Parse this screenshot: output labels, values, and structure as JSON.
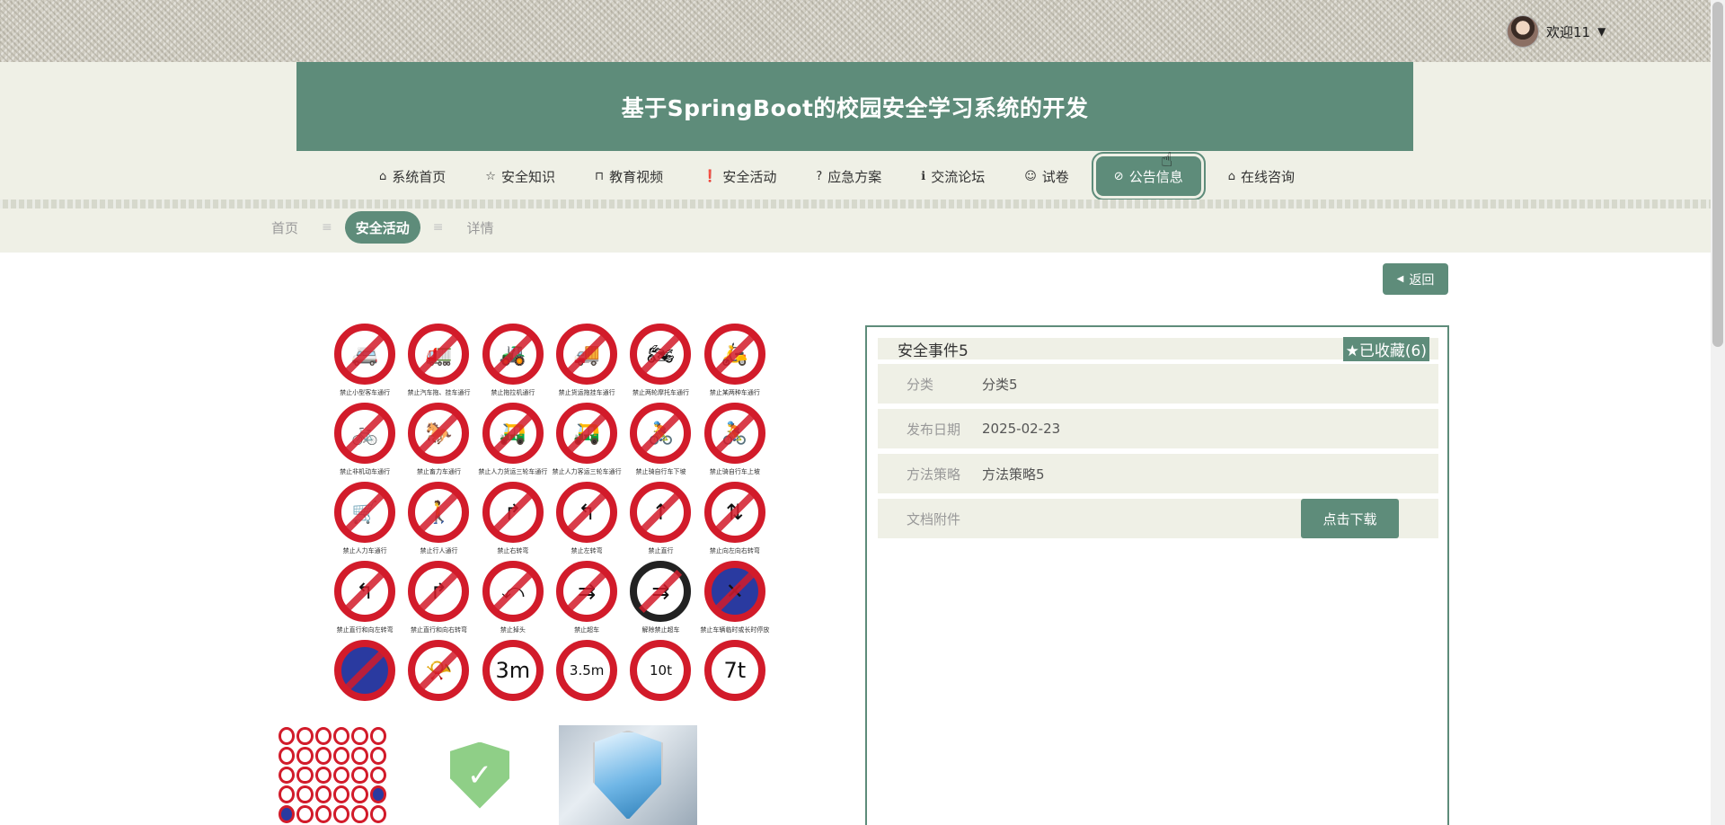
{
  "header": {
    "user_greeting": "欢迎11",
    "caret": "▼",
    "site_title": "基于SpringBoot的校园安全学习系统的开发"
  },
  "nav": {
    "items": [
      {
        "label": "系统首页",
        "icon": "home-icon",
        "glyph": "⌂"
      },
      {
        "label": "安全知识",
        "icon": "star-icon",
        "glyph": "☆"
      },
      {
        "label": "教育视频",
        "icon": "bag-icon",
        "glyph": "⊓"
      },
      {
        "label": "安全活动",
        "icon": "exclamation-circle-icon",
        "glyph": "❗"
      },
      {
        "label": "应急方案",
        "icon": "question-circle-icon",
        "glyph": "?"
      },
      {
        "label": "交流论坛",
        "icon": "info-circle-icon",
        "glyph": "ℹ"
      },
      {
        "label": "试卷",
        "icon": "smile-icon",
        "glyph": "☺"
      },
      {
        "label": "公告信息",
        "icon": "check-circle-icon",
        "glyph": "⊘"
      },
      {
        "label": "在线咨询",
        "icon": "home-icon",
        "glyph": "⌂"
      }
    ],
    "active_index": 7
  },
  "breadcrumb": {
    "home": "首页",
    "current": "安全活动",
    "detail": "详情",
    "separator": "≡"
  },
  "back_button": {
    "label": "返回",
    "icon": "caret-left-icon",
    "glyph": "◀"
  },
  "main_image": {
    "signs": [
      {
        "caption": "禁止小型客车通行",
        "glyph": "🚐"
      },
      {
        "caption": "禁止汽车拖、挂车通行",
        "glyph": "🚛"
      },
      {
        "caption": "禁止拖拉机通行",
        "glyph": "🚜"
      },
      {
        "caption": "禁止货运拖挂车通行",
        "glyph": "🚚"
      },
      {
        "caption": "禁止两轮摩托车通行",
        "glyph": "🏍"
      },
      {
        "caption": "禁止某两种车通行",
        "glyph": "🛵"
      },
      {
        "caption": "禁止非机动车通行",
        "glyph": "🚲"
      },
      {
        "caption": "禁止畜力车通行",
        "glyph": "🐎"
      },
      {
        "caption": "禁止人力货运三轮车通行",
        "glyph": "🛺"
      },
      {
        "caption": "禁止人力客运三轮车通行",
        "glyph": "🛺"
      },
      {
        "caption": "禁止骑自行车下坡",
        "glyph": "🚴"
      },
      {
        "caption": "禁止骑自行车上坡",
        "glyph": "🚴"
      },
      {
        "caption": "禁止人力车通行",
        "glyph": "🛒"
      },
      {
        "caption": "禁止行人通行",
        "glyph": "🚶"
      },
      {
        "caption": "禁止右转弯",
        "glyph": "↱"
      },
      {
        "caption": "禁止左转弯",
        "glyph": "↰"
      },
      {
        "caption": "禁止直行",
        "glyph": "↑"
      },
      {
        "caption": "禁止向左向右转弯",
        "glyph": "⇅"
      },
      {
        "caption": "禁止直行和向左转弯",
        "glyph": "↰"
      },
      {
        "caption": "禁止直行和向右转弯",
        "glyph": "↱"
      },
      {
        "caption": "禁止掉头",
        "glyph": "⤺"
      },
      {
        "caption": "禁止超车",
        "glyph": "⇉"
      },
      {
        "caption": "解除禁止超车",
        "glyph": "⇉"
      },
      {
        "caption": "禁止车辆临时或长时停放",
        "glyph": "✕"
      },
      {
        "caption": "",
        "glyph": ""
      },
      {
        "caption": "",
        "glyph": "📯"
      },
      {
        "caption": "",
        "glyph": "3m"
      },
      {
        "caption": "",
        "glyph": "3.5m"
      },
      {
        "caption": "",
        "glyph": "10t"
      },
      {
        "caption": "",
        "glyph": "7t"
      }
    ]
  },
  "detail": {
    "title": "安全事件5",
    "favorite_label": "★已收藏(6)",
    "fields": [
      {
        "label": "分类",
        "value": "分类5"
      },
      {
        "label": "发布日期",
        "value": "2025-02-23"
      },
      {
        "label": "方法策略",
        "value": "方法策略5"
      },
      {
        "label": "文档附件",
        "value": ""
      }
    ],
    "download_label": "点击下载"
  },
  "colors": {
    "primary": "#5e8c7a",
    "band": "#eff0e6",
    "sign_red": "#d21b2a",
    "sign_blue": "#2a3aa0"
  }
}
